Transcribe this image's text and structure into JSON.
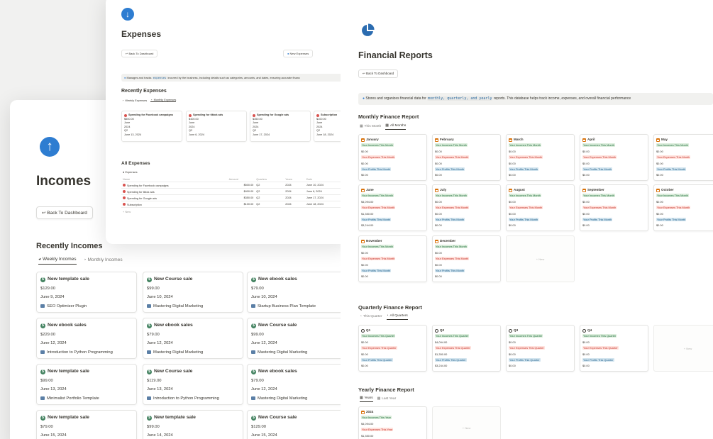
{
  "expenses": {
    "title": "Expenses",
    "back_btn": "Back To Dashboard",
    "new_btn": "New Expenses",
    "callout_pre": "Manages and tracks",
    "callout_code": "expenses",
    "callout_post": "incurred by the business, including details such as categories, amounts, and dates, ensuring accurate financ",
    "recent_title": "Recently Expenses",
    "tabs": [
      "Weekly Expenses",
      "Monthly Expenses"
    ],
    "cards": [
      {
        "title": "Spending for Facebook campaigns",
        "amount": "$500.00",
        "month": "June",
        "year": "2024",
        "quarter": "Q2",
        "date": "June 13, 2024"
      },
      {
        "title": "Spending for tiktok ads",
        "amount": "$400.00",
        "month": "June",
        "year": "2024",
        "quarter": "Q2",
        "date": "June 6, 2024"
      },
      {
        "title": "Spending for Google ads",
        "amount": "$350.00",
        "month": "June",
        "year": "2024",
        "quarter": "Q2",
        "date": "June 17, 2024"
      },
      {
        "title": "Subscription",
        "amount": "$100.00",
        "month": "June",
        "year": "2024",
        "quarter": "Q2",
        "date": "June 18, 2024"
      }
    ],
    "all_title": "All Expenses",
    "all_sub": "Expenses",
    "columns": [
      "Name",
      "Amount",
      "Quarters",
      "Years",
      "Date"
    ],
    "rows": [
      [
        "Spending for Facebook campaigns",
        "$500.00",
        "Q2",
        "2024",
        "June 10, 2024"
      ],
      [
        "Spending for tiktok ads",
        "$400.00",
        "Q2",
        "2024",
        "June 6, 2024"
      ],
      [
        "Spending for Google ads",
        "$350.00",
        "Q2",
        "2024",
        "June 17, 2024"
      ],
      [
        "Subscription",
        "$100.00",
        "Q2",
        "2024",
        "June 18, 2024"
      ]
    ],
    "new_row": "+ New"
  },
  "incomes": {
    "title": "Incomes",
    "back_btn": "Back To Dashboard",
    "recent_title": "Recently Incomes",
    "tabs": [
      "Weekly Incomes",
      "Monthly Incomes"
    ],
    "cards": [
      {
        "title": "New template sale",
        "amount": "$129.00",
        "date": "June 9, 2024",
        "product": "SEO Optimizer Plugin"
      },
      {
        "title": "New Course sale",
        "amount": "$99.00",
        "date": "June 10, 2024",
        "product": "Mastering Digital Marketing"
      },
      {
        "title": "New ebook sales",
        "amount": "$79.00",
        "date": "June 10, 2024",
        "product": "Startup Business Plan Template"
      },
      {
        "title": "New ebook sales",
        "amount": "$229.00",
        "date": "June 12, 2024",
        "product": "Introduction to Python Programming"
      },
      {
        "title": "New ebook sales",
        "amount": "$79.00",
        "date": "June 12, 2024",
        "product": "Mastering Digital Marketing"
      },
      {
        "title": "New Course sale",
        "amount": "$99.00",
        "date": "June 12, 2024",
        "product": "Mastering Digital Marketing"
      },
      {
        "title": "New template sale",
        "amount": "$99.00",
        "date": "June 13, 2024",
        "product": "Minimalist Portfolio Template"
      },
      {
        "title": "New Course sale",
        "amount": "$119.00",
        "date": "June 13, 2024",
        "product": "Introduction to Python Programming"
      },
      {
        "title": "New ebook sales",
        "amount": "$79.00",
        "date": "June 12, 2024",
        "product": "Mastering Digital Marketing"
      },
      {
        "title": "New template sale",
        "amount": "$79.00",
        "date": "June 15, 2024",
        "product": ""
      },
      {
        "title": "New template sale",
        "amount": "$99.00",
        "date": "June 14, 2024",
        "product": ""
      },
      {
        "title": "New Course sale",
        "amount": "$129.00",
        "date": "June 15, 2024",
        "product": ""
      }
    ]
  },
  "reports": {
    "title": "Financial Reports",
    "back_btn": "Back To Dashboard",
    "callout_pre": "Stores and organizes financial data for",
    "callout_code": "monthly, quarterly, and yearly",
    "callout_post": "reports. This database helps track income, expenses, and overall financial performance",
    "monthly_title": "Monthly Finance Report",
    "monthly_tabs": [
      "This Month",
      "All Months"
    ],
    "label_income_month": "Your Incomes This Month",
    "label_expense_month": "Your Expenses This Month",
    "label_profit_month": "Your Profits This Month",
    "months": [
      {
        "name": "January",
        "income": "$0.00",
        "expense": "$0.00",
        "profit": "$0.00"
      },
      {
        "name": "February",
        "income": "$0.00",
        "expense": "$0.00",
        "profit": "$0.00"
      },
      {
        "name": "March",
        "income": "$0.00",
        "expense": "$0.00",
        "profit": "$0.00"
      },
      {
        "name": "April",
        "income": "$0.00",
        "expense": "$0.00",
        "profit": "$0.00"
      },
      {
        "name": "May",
        "income": "$0.00",
        "expense": "$0.00",
        "profit": "$0.00"
      },
      {
        "name": "June",
        "income": "$4,094.00",
        "expense": "$1,350.00",
        "profit": "$3,244.00"
      },
      {
        "name": "July",
        "income": "$0.00",
        "expense": "$0.00",
        "profit": "$0.00"
      },
      {
        "name": "August",
        "income": "$0.00",
        "expense": "$0.00",
        "profit": "$0.00"
      },
      {
        "name": "September",
        "income": "$0.00",
        "expense": "$0.00",
        "profit": "$0.00"
      },
      {
        "name": "October",
        "income": "$0.00",
        "expense": "$0.00",
        "profit": "$0.00"
      },
      {
        "name": "November",
        "income": "$0.00",
        "expense": "$0.00",
        "profit": "$0.00"
      },
      {
        "name": "December",
        "income": "$0.00",
        "expense": "$0.00",
        "profit": "$0.00"
      }
    ],
    "new_label": "+ New",
    "quarterly_title": "Quarterly Finance Report",
    "quarterly_tabs": [
      "This Quarter",
      "All Quarters"
    ],
    "label_income_quarter": "Your Incomes This Quarter",
    "label_expense_quarter": "Your Expenses This Quarter",
    "label_profit_quarter": "Your Profits This Quarter",
    "quarters": [
      {
        "name": "Q1",
        "income": "$0.00",
        "expense": "$0.00",
        "profit": "$0.00"
      },
      {
        "name": "Q2",
        "income": "$4,094.00",
        "expense": "$1,350.00",
        "profit": "$3,244.00"
      },
      {
        "name": "Q3",
        "income": "$0.00",
        "expense": "$0.00",
        "profit": "$0.00"
      },
      {
        "name": "Q4",
        "income": "$0.00",
        "expense": "$0.00",
        "profit": "$0.00"
      }
    ],
    "yearly_title": "Yearly Finance Report",
    "yearly_tabs": [
      "Years",
      "Last Year"
    ],
    "label_income_year": "Your Incomes This Year",
    "label_expense_year": "Your Expenses This Year",
    "year": {
      "name": "2024",
      "income": "$4,094.00",
      "expense": "$1,350.00"
    }
  }
}
